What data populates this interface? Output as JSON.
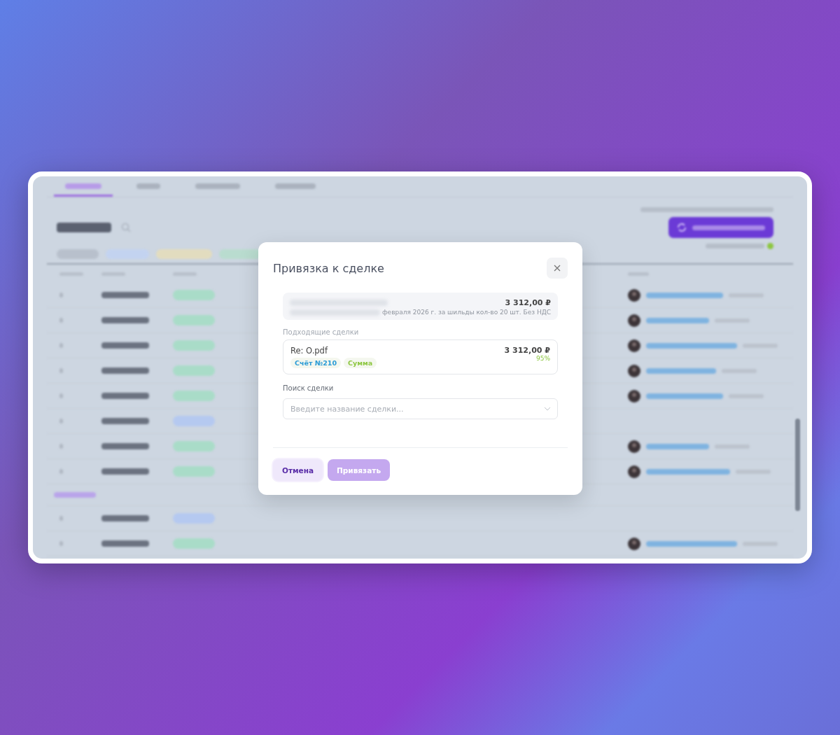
{
  "app": {
    "tabs": [
      {
        "selected": true
      },
      {
        "selected": false
      },
      {
        "selected": false
      },
      {
        "selected": false
      }
    ],
    "filters": [
      {
        "color": "#b8c0cc"
      },
      {
        "color": "#c3d3f0"
      },
      {
        "color": "#e2dcbf"
      },
      {
        "color": "#b9dccf"
      }
    ],
    "rows": [
      {
        "kind": "row",
        "color": "#a9dcc8",
        "linked": true
      },
      {
        "kind": "row",
        "color": "#a9dcc8",
        "linked": true
      },
      {
        "kind": "row",
        "color": "#a9dcc8",
        "linked": true
      },
      {
        "kind": "row",
        "color": "#a9dcc8",
        "linked": true
      },
      {
        "kind": "row",
        "color": "#a9dcc8",
        "linked": true
      },
      {
        "kind": "row",
        "color": "#b5c9f0",
        "linked": false
      },
      {
        "kind": "row",
        "color": "#a9dcc8",
        "linked": true
      },
      {
        "kind": "row",
        "color": "#a9dcc8",
        "linked": true
      },
      {
        "kind": "group"
      },
      {
        "kind": "row",
        "color": "#b5c9f0",
        "linked": false
      },
      {
        "kind": "row",
        "color": "#a9dcc8",
        "linked": true
      }
    ]
  },
  "dialog": {
    "title": "Привязка к сделке",
    "payment": {
      "amount": "3 312,00 ₽",
      "purpose": "февраля 2026 г. за шильды кол-во 20 шт. Без НДС"
    },
    "matches_label": "Подходящие сделки",
    "matches": [
      {
        "name": "Re: O.pdf",
        "amount": "3 312,00 ₽",
        "score": "95%",
        "tags": [
          {
            "label": "Счёт №210",
            "color": "#2a9bd6"
          },
          {
            "label": "Сумма",
            "color": "#8cc63f"
          }
        ]
      }
    ],
    "search_label": "Поиск сделки",
    "search": {
      "placeholder": "Введите название сделки..."
    },
    "buttons": [
      {
        "label": "Отмена",
        "kind": "secondary",
        "disabled": false
      },
      {
        "label": "Привязать",
        "kind": "primary",
        "disabled": true
      }
    ]
  }
}
